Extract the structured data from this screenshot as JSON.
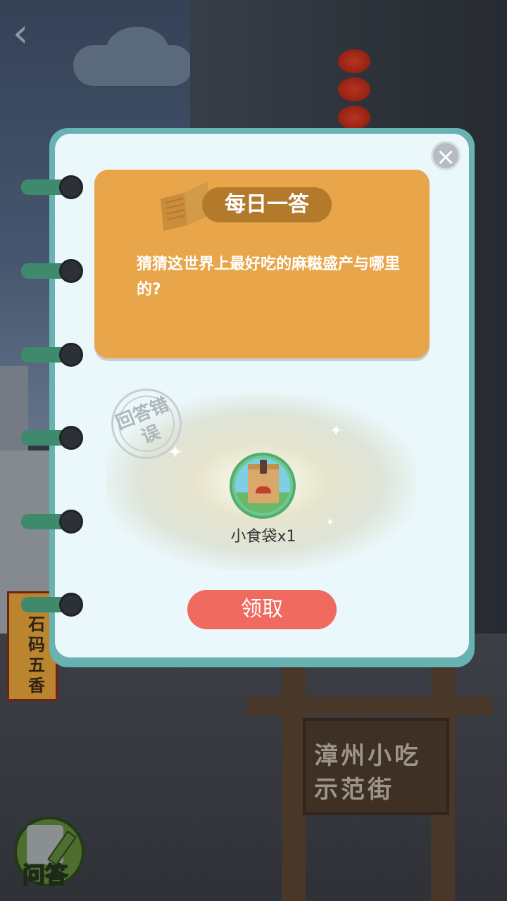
{
  "header": {
    "back_icon": "chevron-left-icon"
  },
  "modal": {
    "title": "每日一答",
    "question": "猜猜这世界上最好吃的麻糍盛产与哪里的?",
    "stamp_text": "回答错误",
    "reward": {
      "name": "小食袋x1",
      "icon": "food-bag-icon"
    },
    "claim_label": "领取",
    "close_icon": "close-icon",
    "colors": {
      "card": "#e8a54a",
      "frame": "#69b2b2",
      "claim": "#f06a5f"
    }
  },
  "background": {
    "street_sign": "漳州小吃示范街",
    "banner": "石码五香"
  },
  "qa_button": {
    "label": "问答",
    "icon": "notebook-pen-icon"
  }
}
